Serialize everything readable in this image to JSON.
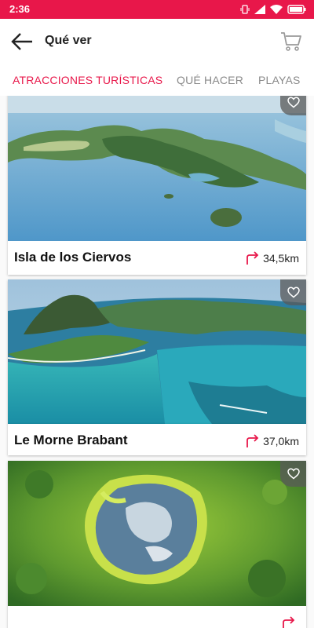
{
  "status_bar": {
    "time": "2:36",
    "battery_icon": "battery-icon",
    "wifi_icon": "wifi-icon",
    "signal_icon": "signal-icon"
  },
  "app_bar": {
    "title": "Qué ver",
    "back_icon": "arrow-left-icon",
    "cart_icon": "cart-icon"
  },
  "tabs": [
    {
      "label": "ATRACCIONES TURÍSTICAS",
      "active": true
    },
    {
      "label": "QUÉ HACER",
      "active": false
    },
    {
      "label": "PLAYAS",
      "active": false
    }
  ],
  "cards": [
    {
      "name": "Isla de los Ciervos",
      "distance": "34,5km",
      "image": "aerial-island-lagoon"
    },
    {
      "name": "Le Morne Brabant",
      "distance": "37,0km",
      "image": "mountain-coast-lagoon"
    },
    {
      "name": "",
      "distance": "",
      "image": "crater-lake-forest"
    }
  ],
  "colors": {
    "accent": "#e8174a",
    "tab_inactive": "#8a8a8a"
  }
}
